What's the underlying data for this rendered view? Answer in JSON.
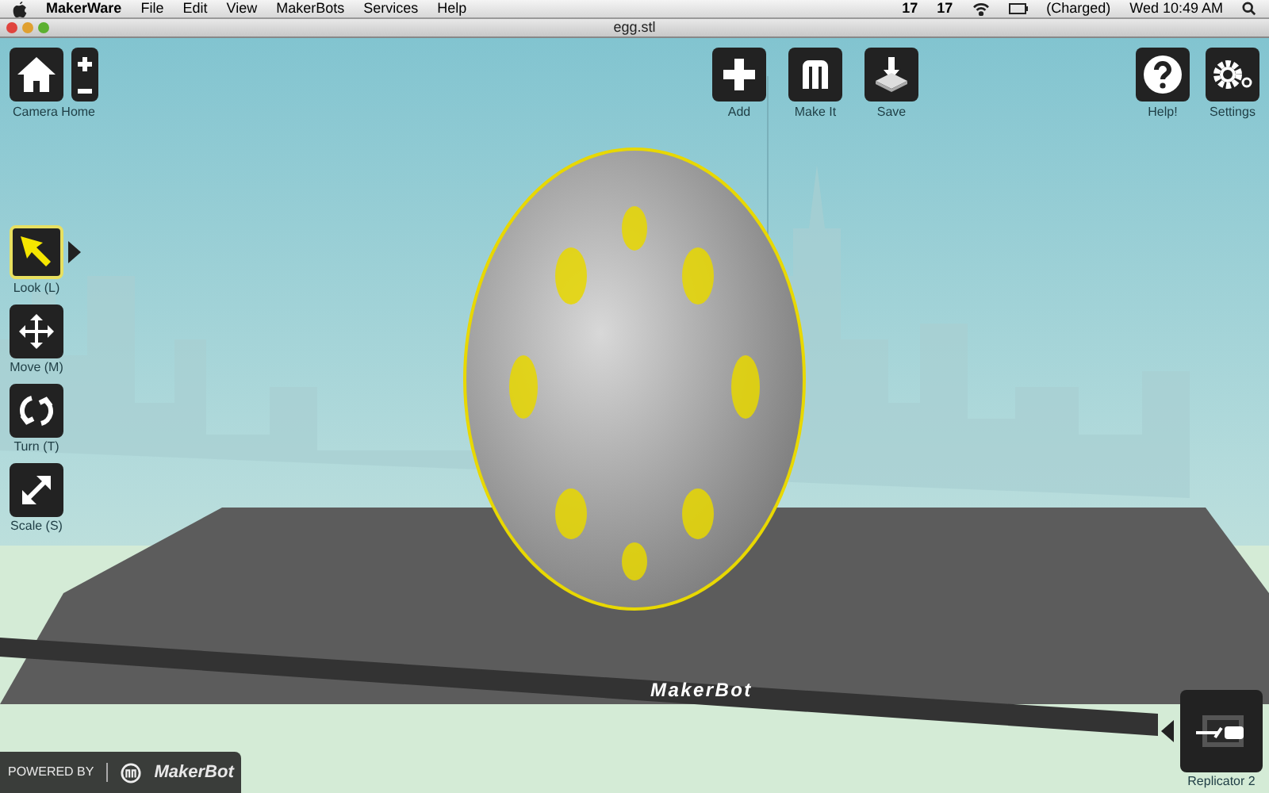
{
  "menu_bar": {
    "app": "MakerWare",
    "items": [
      "File",
      "Edit",
      "View",
      "MakerBots",
      "Services",
      "Help"
    ],
    "status": {
      "adobe_1": "17",
      "adobe_2": "17",
      "battery": "(Charged)",
      "clock": "Wed 10:49 AM"
    }
  },
  "window": {
    "title": "egg.stl"
  },
  "camera": {
    "label": "Camera Home"
  },
  "top_tools": [
    {
      "kind": "add",
      "label": "Add"
    },
    {
      "kind": "make",
      "label": "Make It"
    },
    {
      "kind": "save",
      "label": "Save"
    }
  ],
  "help": {
    "label": "Help!"
  },
  "settings": {
    "label": "Settings"
  },
  "side_tools": [
    {
      "kind": "look",
      "label": "Look (L)",
      "selected": true
    },
    {
      "kind": "move",
      "label": "Move (M)",
      "selected": false
    },
    {
      "kind": "turn",
      "label": "Turn (T)",
      "selected": false
    },
    {
      "kind": "scale",
      "label": "Scale (S)",
      "selected": false
    }
  ],
  "platform": {
    "brand": "MakerBot"
  },
  "device": {
    "label": "Replicator 2"
  },
  "footer": {
    "powered_by": "POWERED BY",
    "brand": "MakerBot"
  }
}
